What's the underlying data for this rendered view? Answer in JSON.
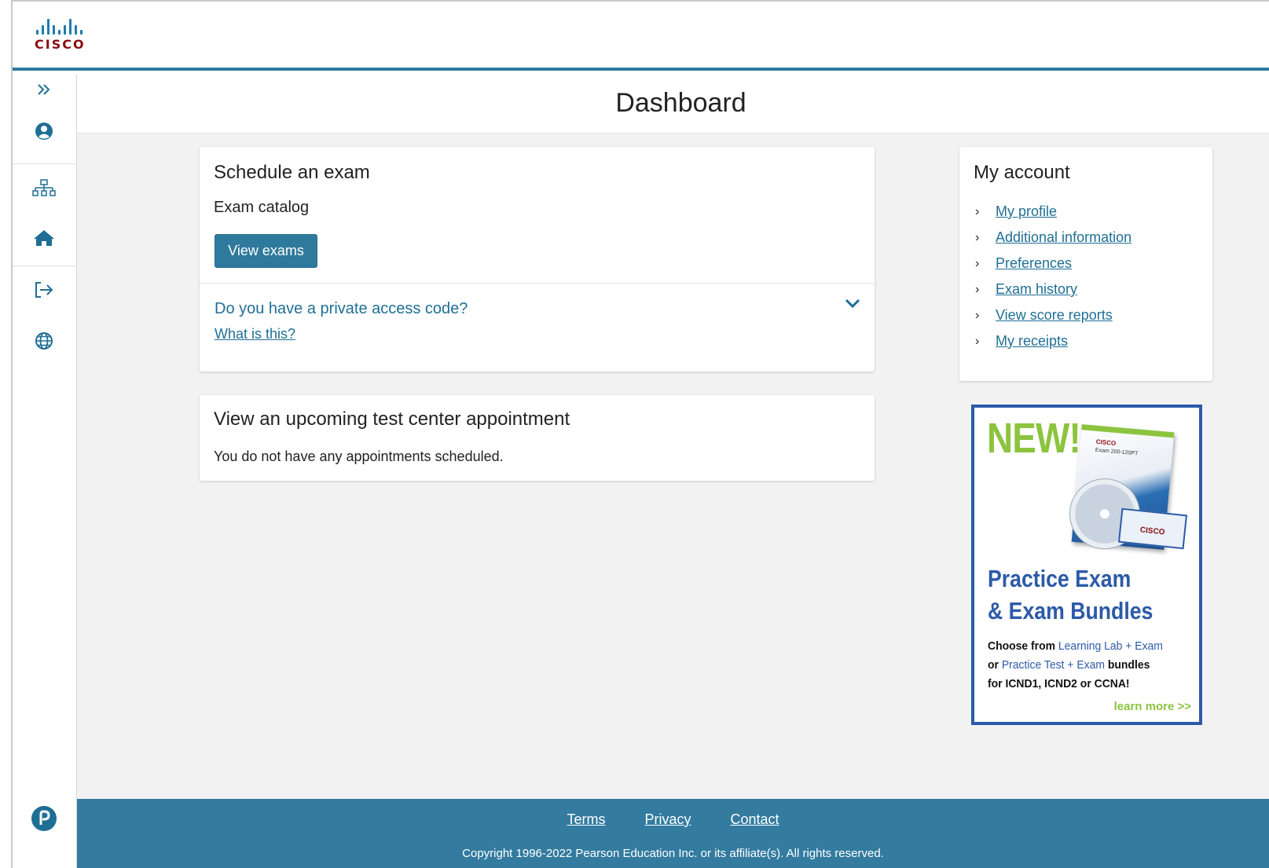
{
  "brand": {
    "logo_text": "CISCO"
  },
  "sidebar": {
    "items": [
      {
        "name": "expand",
        "icon": "double-chevron-right-icon"
      },
      {
        "name": "profile",
        "icon": "user-circle-icon"
      },
      {
        "name": "sitemap",
        "icon": "sitemap-icon"
      },
      {
        "name": "home",
        "icon": "home-icon"
      },
      {
        "name": "logout",
        "icon": "sign-out-icon"
      },
      {
        "name": "language",
        "icon": "globe-icon"
      }
    ],
    "bottom_icon": "pearson-logo-icon"
  },
  "page": {
    "title": "Dashboard"
  },
  "schedule": {
    "heading": "Schedule an exam",
    "catalog_label": "Exam catalog",
    "view_exams_label": "View exams",
    "private_code_question": "Do you have a private access code?",
    "what_is_this": "What is this?"
  },
  "appointments": {
    "heading": "View an upcoming test center appointment",
    "empty_message": "You do not have any appointments scheduled."
  },
  "account": {
    "heading": "My account",
    "links": [
      "My profile",
      "Additional information",
      "Preferences",
      "Exam history",
      "View score reports",
      "My receipts"
    ]
  },
  "ad": {
    "badge": "NEW!",
    "line1": "Practice Exam",
    "line2": "& Exam Bundles",
    "body_1a": "Choose from ",
    "body_1b": "Learning Lab + Exam",
    "body_2a": "or ",
    "body_2b": "Practice Test + Exam",
    "body_2c": " bundles",
    "body_3": "for ICND1, ICND2 or CCNA!",
    "cta": "learn more >>",
    "box_cisco": "CISCO",
    "box_exam": "Exam 200-120PT",
    "colors": {
      "green": "#8cc43f",
      "blue": "#2c5aa8"
    }
  },
  "footer": {
    "links": [
      "Terms",
      "Privacy",
      "Contact"
    ],
    "copyright": "Copyright 1996-2022 Pearson Education Inc. or its affiliate(s). All rights reserved."
  },
  "colors": {
    "accent": "#2f7a9c",
    "brand_red": "#8a0a10",
    "footer": "#337b9f"
  }
}
